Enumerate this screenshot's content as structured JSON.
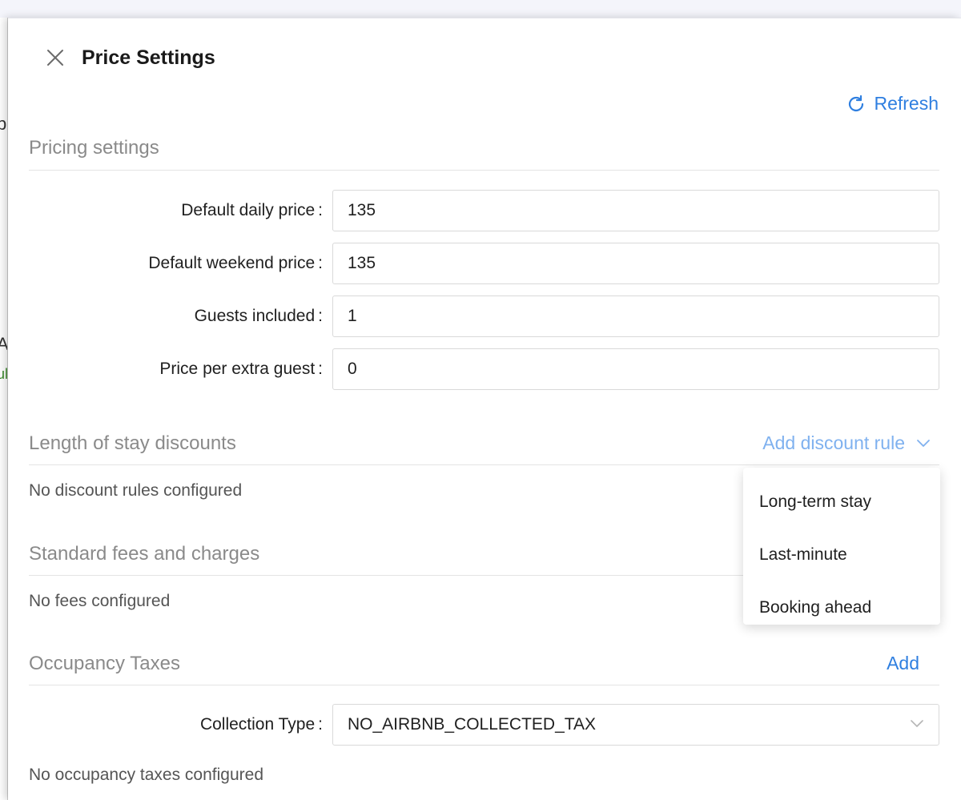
{
  "backdrop": {
    "peek_chars": [
      "p",
      "A",
      "ul"
    ]
  },
  "header": {
    "title": "Price Settings",
    "close_icon": "close-icon"
  },
  "refresh": {
    "label": "Refresh",
    "icon": "refresh-icon"
  },
  "pricing": {
    "section_title": "Pricing settings",
    "fields": [
      {
        "label": "Default daily price",
        "value": "135"
      },
      {
        "label": "Default weekend price",
        "value": "135"
      },
      {
        "label": "Guests included",
        "value": "1"
      },
      {
        "label": "Price per extra guest",
        "value": "0"
      }
    ]
  },
  "discounts": {
    "section_title": "Length of stay discounts",
    "add_label": "Add discount rule",
    "empty_text": "No discount rules configured",
    "menu": [
      "Long-term stay",
      "Last-minute",
      "Booking ahead"
    ]
  },
  "fees": {
    "section_title": "Standard fees and charges",
    "empty_text": "No fees configured"
  },
  "taxes": {
    "section_title": "Occupancy Taxes",
    "add_label": "Add",
    "collection_label": "Collection Type",
    "collection_value": "NO_AIRBNB_COLLECTED_TAX",
    "empty_text": "No occupancy taxes configured"
  },
  "colors": {
    "link": "#2f7fe0",
    "link_muted": "#7fb1ef",
    "section_title": "#8a8a8a"
  }
}
